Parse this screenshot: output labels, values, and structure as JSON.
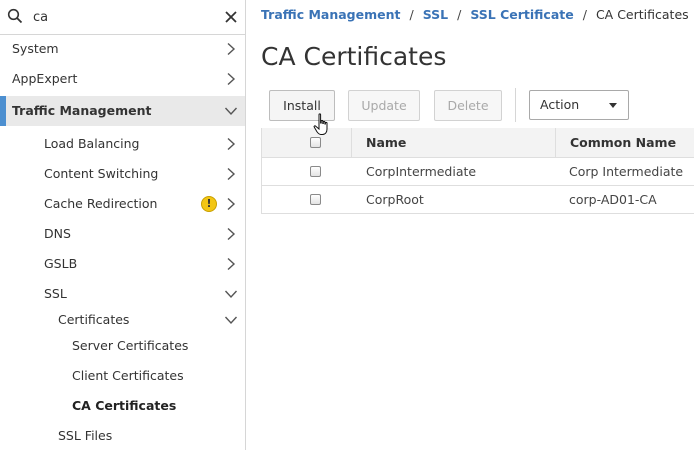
{
  "search": {
    "value": "ca",
    "placeholder": ""
  },
  "sidebar": {
    "items": [
      {
        "label": "System"
      },
      {
        "label": "AppExpert"
      },
      {
        "label": "Traffic Management"
      },
      {
        "label": "Load Balancing"
      },
      {
        "label": "Content Switching"
      },
      {
        "label": "Cache Redirection",
        "badge": "!"
      },
      {
        "label": "DNS"
      },
      {
        "label": "GSLB"
      },
      {
        "label": "SSL"
      },
      {
        "label": "Certificates"
      },
      {
        "label": "Server Certificates"
      },
      {
        "label": "Client Certificates"
      },
      {
        "label": "CA Certificates"
      },
      {
        "label": "SSL Files"
      }
    ]
  },
  "breadcrumb": {
    "items": [
      "Traffic Management",
      "SSL",
      "SSL Certificate"
    ],
    "separator": "/",
    "current": "CA Certificates"
  },
  "page": {
    "title": "CA Certificates"
  },
  "toolbar": {
    "install_label": "Install",
    "update_label": "Update",
    "delete_label": "Delete",
    "action_label": "Action"
  },
  "table": {
    "columns": [
      "Name",
      "Common Name"
    ],
    "rows": [
      {
        "name": "CorpIntermediate",
        "common_name": "Corp Intermediate"
      },
      {
        "name": "CorpRoot",
        "common_name": "corp-AD01-CA"
      }
    ]
  },
  "colors": {
    "accent": "#4c8fd0",
    "link": "#3a73b6",
    "warning": "#f3c614"
  }
}
